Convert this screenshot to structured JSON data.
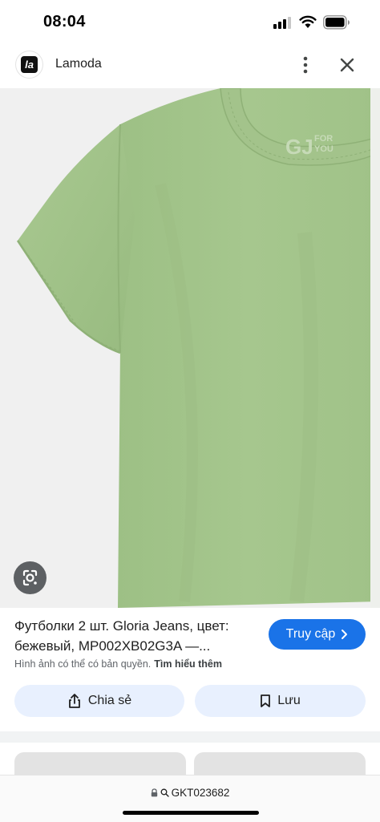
{
  "status_bar": {
    "time": "08:04"
  },
  "header": {
    "logo_text": "la",
    "site_name": "Lamoda",
    "more_icon": "more-vertical-icon",
    "close_icon": "close-icon"
  },
  "image": {
    "product": "green t-shirt",
    "brand_print": "GJ FOR YOU",
    "shirt_color": "#a3c58b",
    "lens_icon": "lens-icon"
  },
  "result": {
    "title": "Футболки 2 шт. Gloria Jeans, цвет: бежевый, MP002XB02G3A —...",
    "visit_label": "Truy cập",
    "copyright_notice": "Hình ảnh có thể có bản quyền.",
    "learn_more": "Tìm hiểu thêm",
    "share_label": "Chia sẻ",
    "save_label": "Lưu"
  },
  "url_bar": {
    "url": "GKT023682"
  },
  "colors": {
    "accent": "#1a73e8",
    "action_bg": "#e8f0fe",
    "divider": "#f1f3f4"
  }
}
